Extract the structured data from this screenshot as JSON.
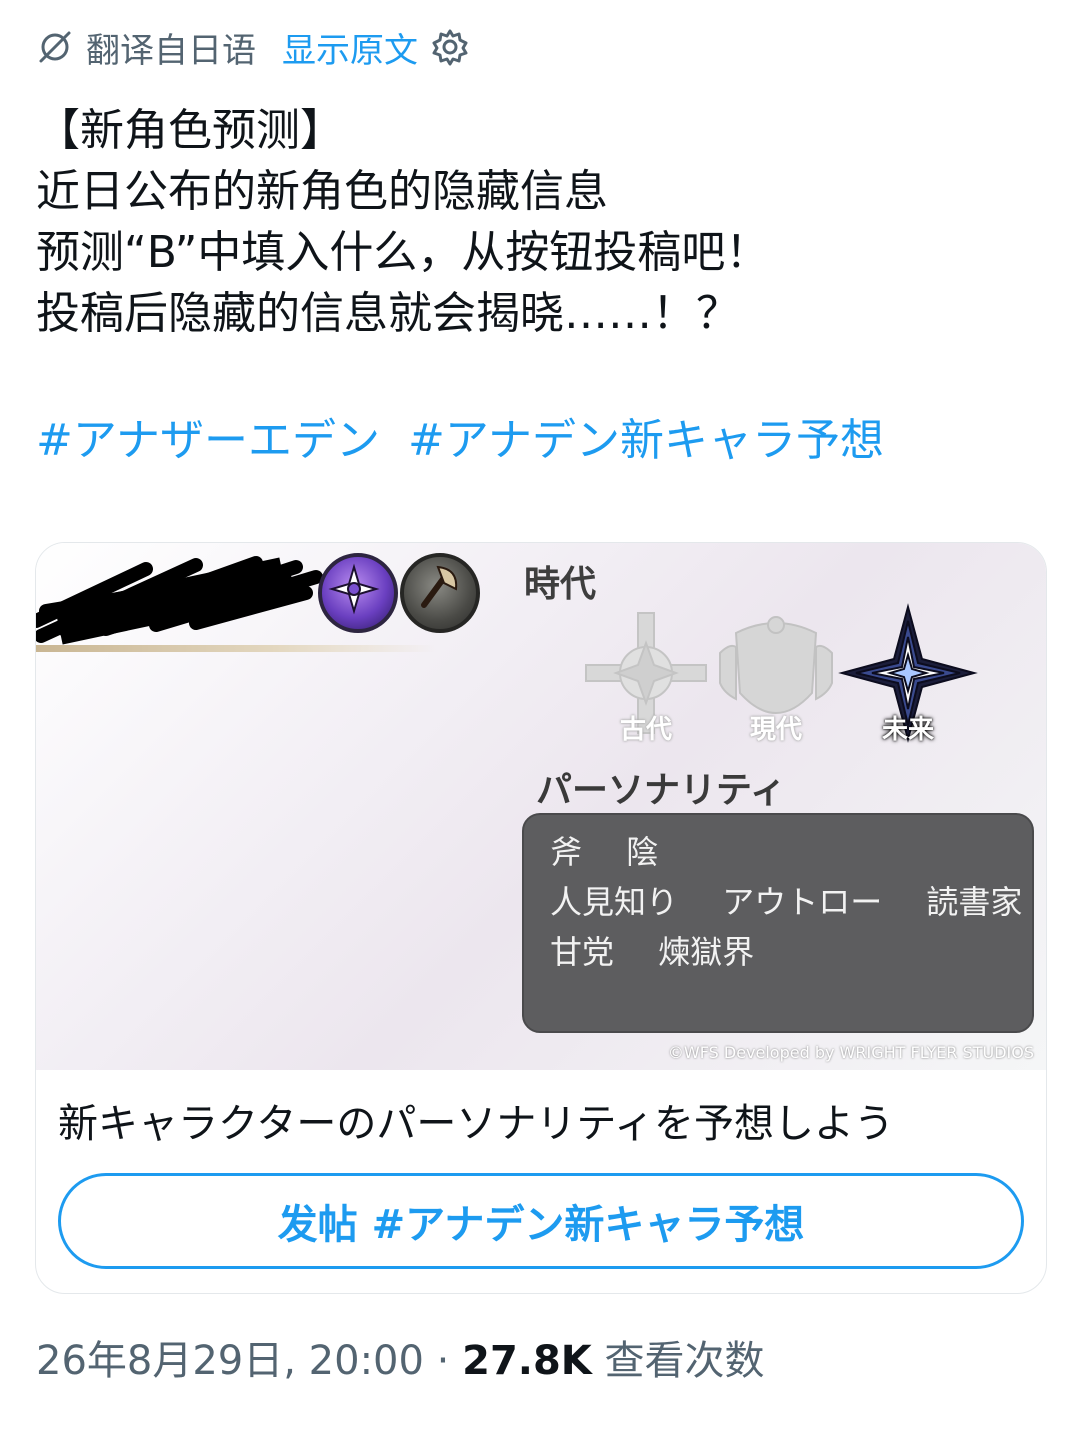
{
  "translate_bar": {
    "label": "翻译自日语",
    "show_original": "显示原文"
  },
  "tweet": {
    "lines": [
      "【新角色预测】",
      "近日公布的新角色的隐藏信息",
      "预测“B”中填入什么，从按钮投稿吧！",
      "投稿后隐藏的信息就会揭晓……！？"
    ],
    "hashtags": [
      "#アナザーエデン",
      "#アナデン新キャラ予想"
    ]
  },
  "card": {
    "era_title": "時代",
    "eras": [
      "古代",
      "現代",
      "未来"
    ],
    "active_era": "未来",
    "personality_title": "パーソナリティ",
    "personality_rows": [
      [
        "斧",
        "陰"
      ],
      [
        "人見知り",
        "アウトロー",
        "読書家"
      ],
      [
        "甘党",
        "煉獄界"
      ]
    ],
    "copyright": "©WFS Developed by WRIGHT FLYER STUDIOS",
    "title": "新キャラクターのパーソナリティを予想しよう",
    "button_label": "发帖 #アナデン新キャラ予想"
  },
  "meta": {
    "timestamp": "26年8月29日, 20:00",
    "separator": "·",
    "views_count": "27.8K",
    "views_label": "查看次数"
  },
  "colors": {
    "link": "#1d9bf0",
    "secondary_text": "#536471",
    "personality_box": "#5d5d5f"
  }
}
